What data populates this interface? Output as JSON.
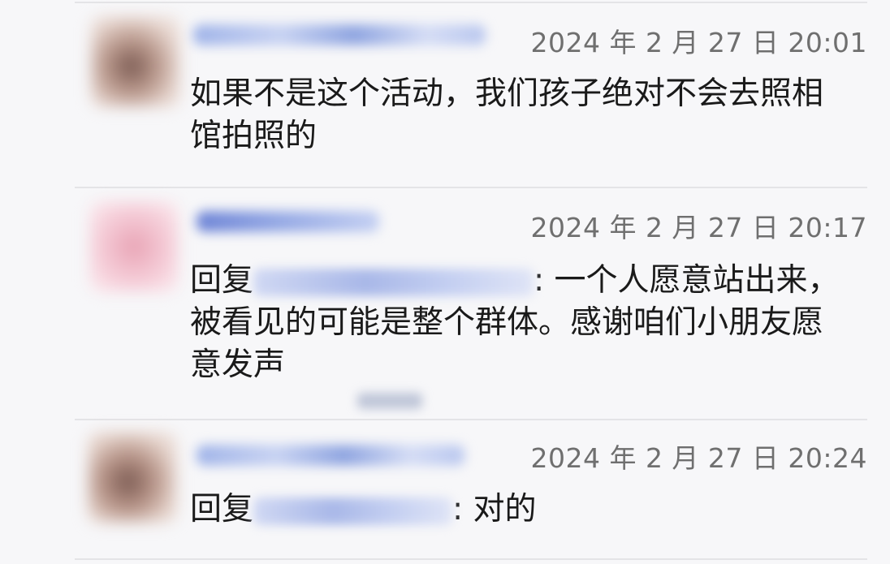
{
  "comments": [
    {
      "timestamp": "2024 年 2 月 27 日  20:01",
      "text": "如果不是这个活动，我们孩子绝对不会去照相馆拍照的"
    },
    {
      "timestamp": "2024 年 2 月 27 日  20:17",
      "reply_prefix": "回复",
      "text": ": 一个人愿意站出来，被看见的可能是整个群体。感谢咱们小朋友愿意发声"
    },
    {
      "timestamp": "2024 年 2 月 27 日  20:24",
      "reply_prefix": "回复",
      "text": ": 对的"
    }
  ],
  "colors": {
    "background": "#f7f7f9",
    "timestamp": "#6f6f6f",
    "text": "#1a1a1a",
    "divider": "#e4e4e7"
  }
}
